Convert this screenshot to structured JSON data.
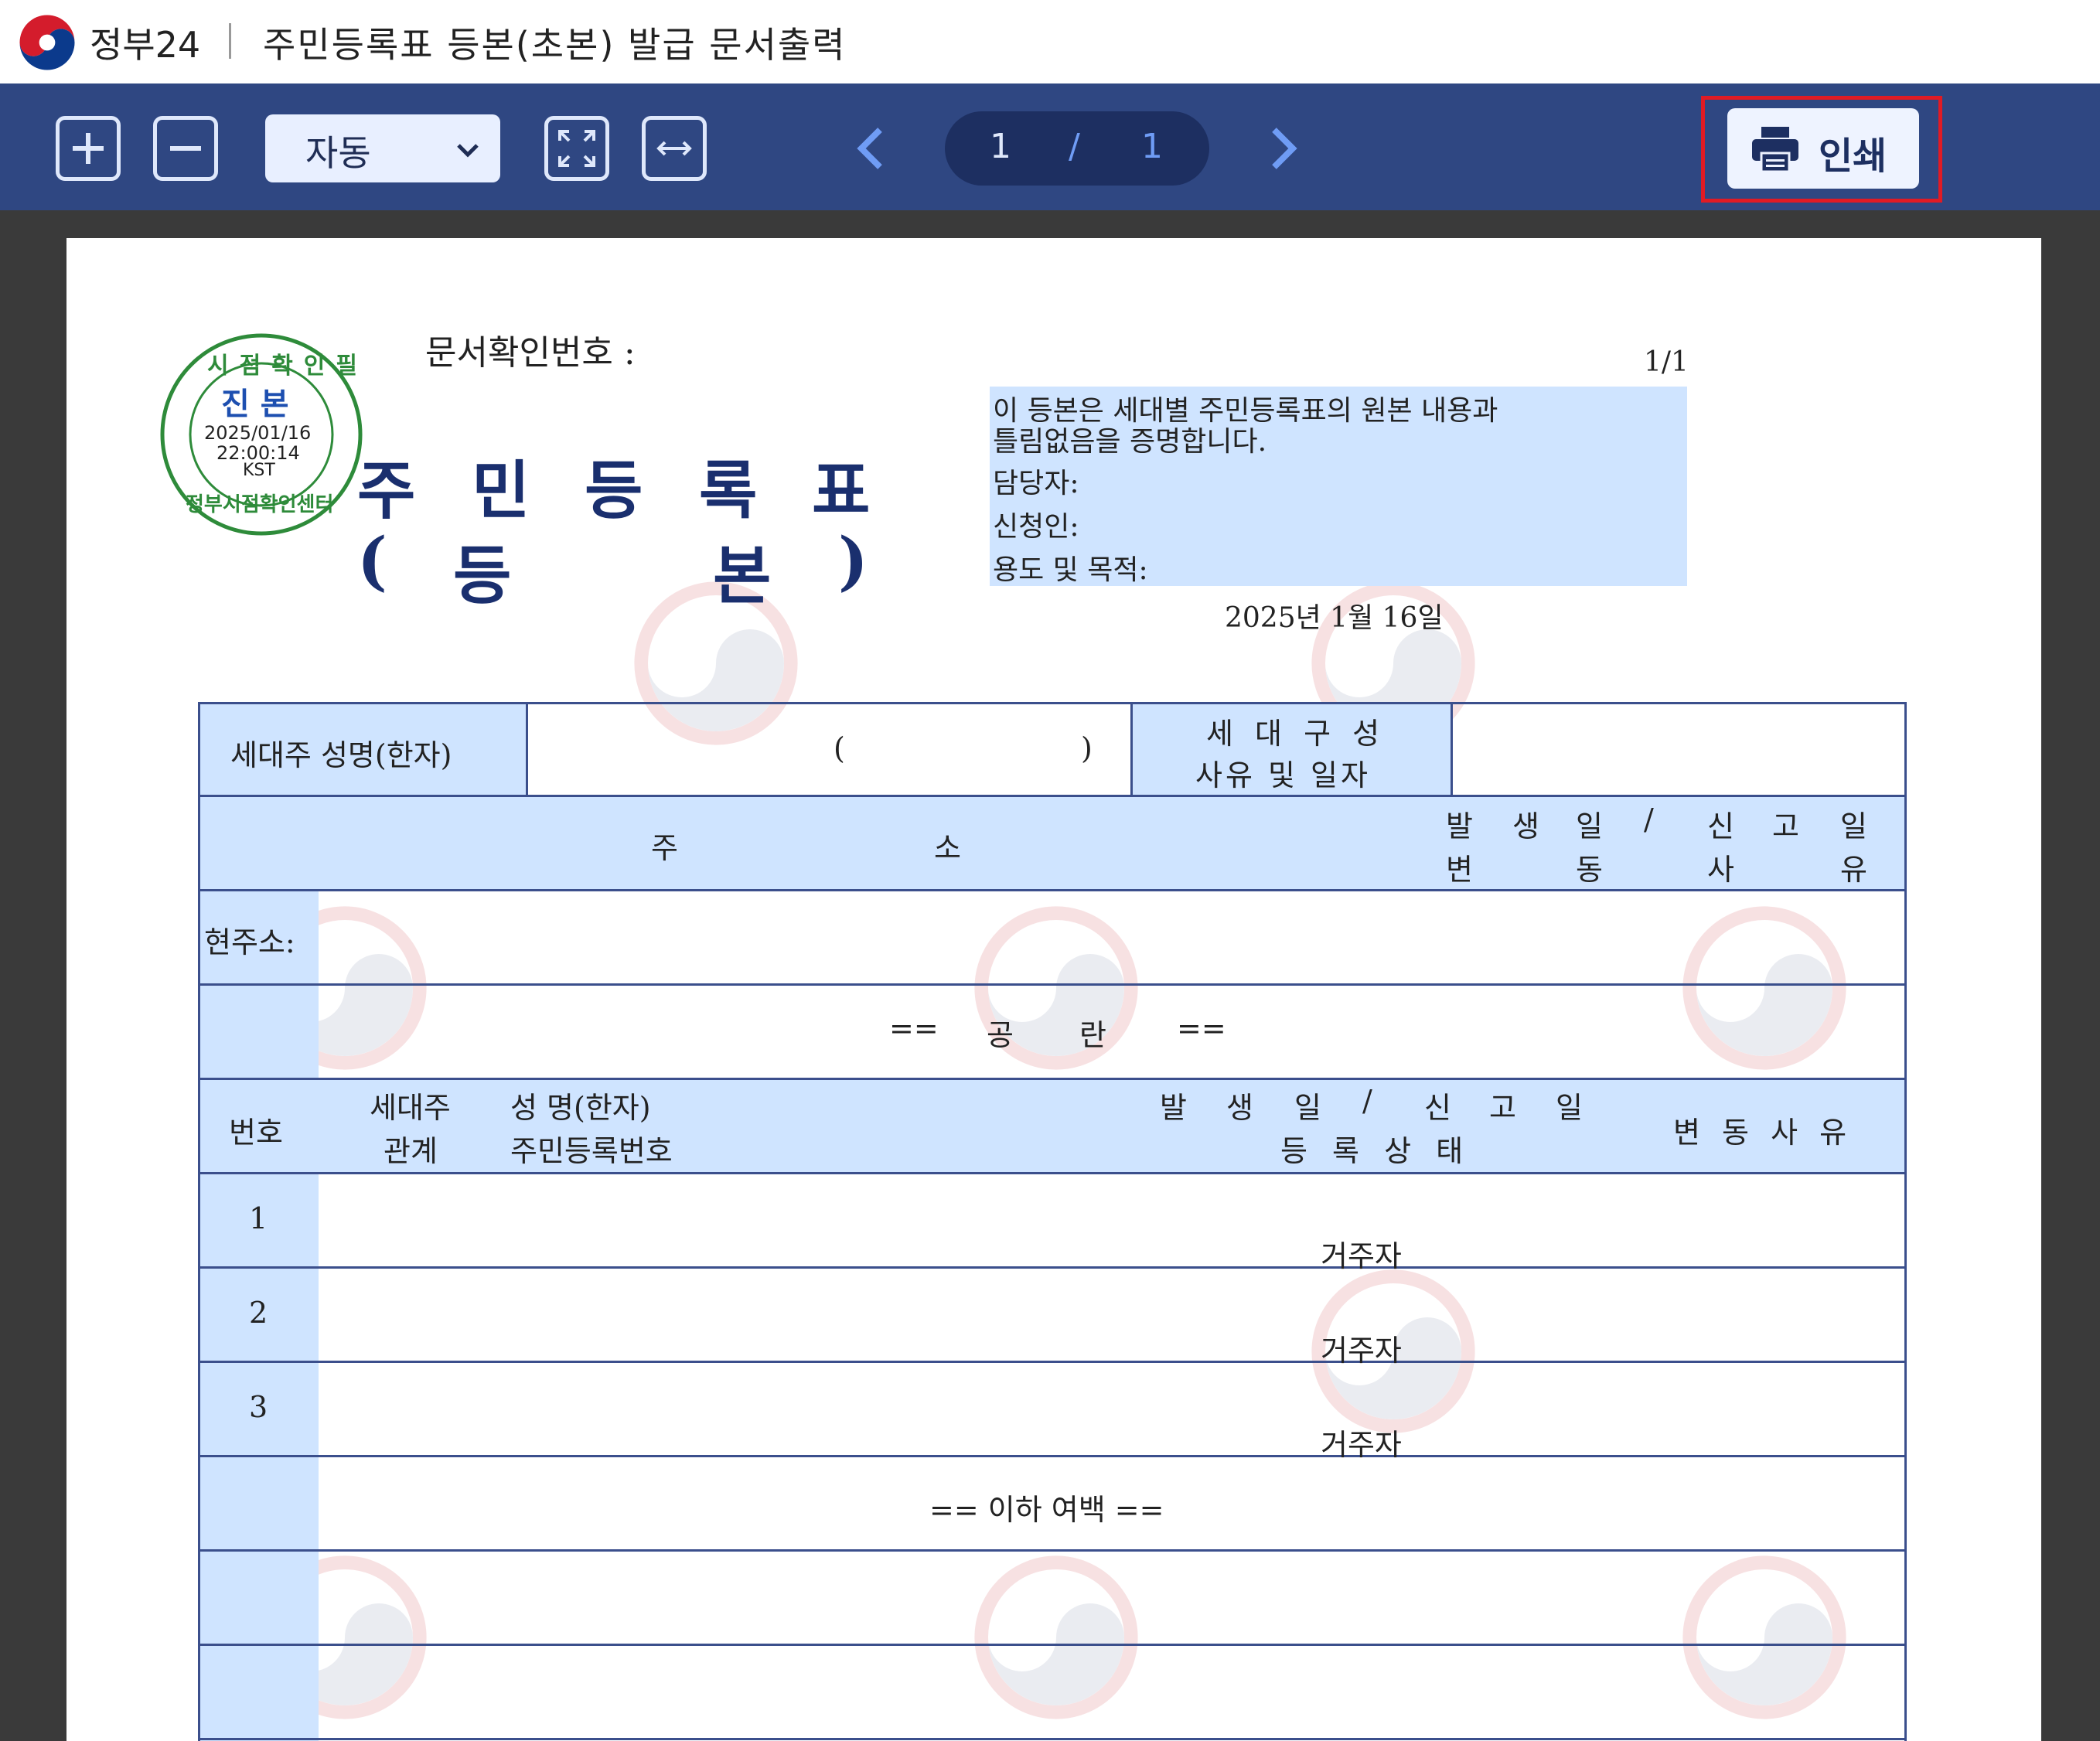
{
  "window": {
    "app_name": "정부24",
    "title": "주민등록표 등본(초본) 발급 문서출력"
  },
  "toolbar": {
    "zoom_value": "자동",
    "page_current": "1",
    "page_sep": "/",
    "page_total": "1",
    "print_label": "인쇄"
  },
  "seal": {
    "top_text": "시점확인필",
    "center_text": "진 본",
    "date": "2025/01/16",
    "time": "22:00:14",
    "tz": "KST",
    "bottom_text": "정부시점확인센터"
  },
  "document": {
    "confirm_label": "문서확인번호 :",
    "page_num": "1/1",
    "title_chars": [
      "주",
      "민",
      "등",
      "록",
      "표"
    ],
    "subtitle_chars": [
      "(",
      "등",
      "본",
      ")"
    ],
    "cert_lines": [
      "이 등본은 세대별 주민등록표의 원본 내용과",
      "틀림없음을 증명합니다.",
      "담당자:",
      "신청인:",
      "용도 및 목적:"
    ],
    "issue_date": "2025년 1월 16일"
  },
  "table": {
    "head_name_label": "세대주 성명(한자)",
    "paren_open": "(",
    "paren_close": ")",
    "household_reason_1": "세 대 구 성",
    "household_reason_2": "사유 및 일자",
    "address_label_1": "주",
    "address_label_2": "소",
    "addr_date_line1": [
      "발",
      "생",
      "일",
      "/",
      "신",
      "고",
      "일"
    ],
    "addr_date_line2": [
      "변",
      "동",
      "사",
      "유"
    ],
    "current_address_label": "현주소:",
    "blank_marker": [
      "==",
      "공",
      "란",
      "=="
    ],
    "col_no": "번호",
    "col_relation_1": "세대주",
    "col_relation_2": "관계",
    "col_name_1": "성  명(한자)",
    "col_name_2": "주민등록번호",
    "col_date_1": [
      "발",
      "생",
      "일",
      "/",
      "신",
      "고",
      "일"
    ],
    "col_date_2": "등 록 상 태",
    "col_reason": "변 동 사 유",
    "rows": [
      {
        "no": "1",
        "status": "거주자"
      },
      {
        "no": "2",
        "status": "거주자"
      },
      {
        "no": "3",
        "status": "거주자"
      }
    ],
    "end_marker": "== 이하 여백 =="
  }
}
